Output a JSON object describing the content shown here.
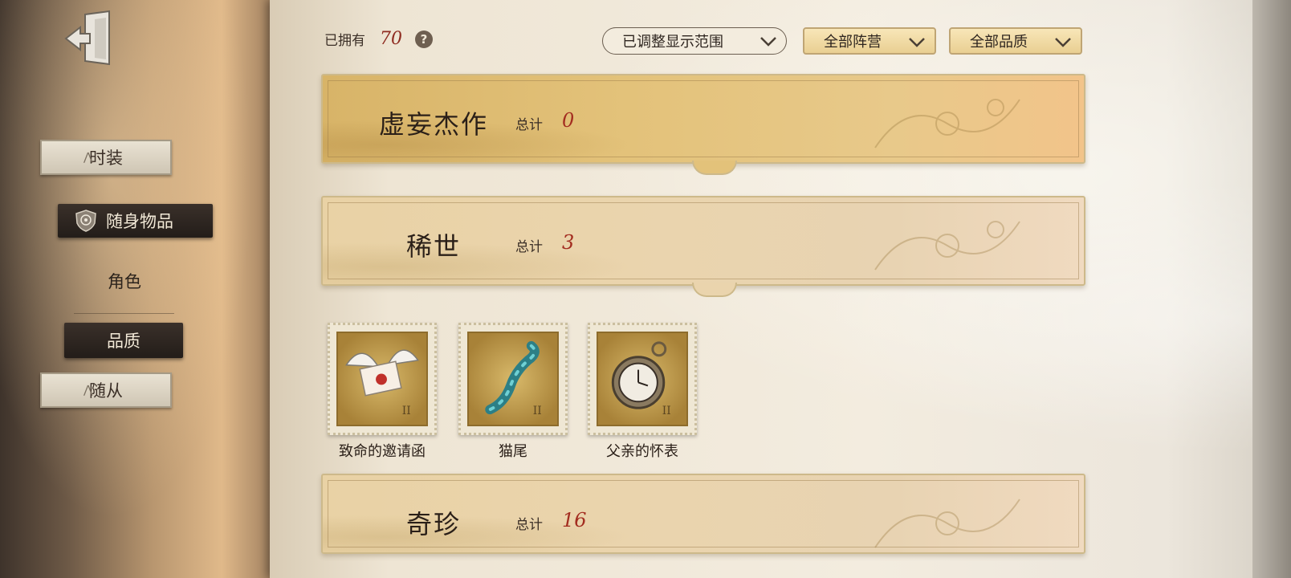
{
  "sidebar": {
    "items": [
      {
        "label": "时装"
      },
      {
        "label": "随身物品"
      },
      {
        "label": "角色"
      },
      {
        "label": "品质"
      },
      {
        "label": "随从"
      }
    ]
  },
  "header": {
    "owned_label": "已拥有",
    "owned_count": "70",
    "help_glyph": "?",
    "range_filter": "已调整显示范围",
    "faction_filter": "全部阵营",
    "quality_filter": "全部品质"
  },
  "sections": [
    {
      "name": "虚妄杰作",
      "total_label": "总计",
      "count": "0"
    },
    {
      "name": "稀世",
      "total_label": "总计",
      "count": "3"
    },
    {
      "name": "奇珍",
      "total_label": "总计",
      "count": "16"
    }
  ],
  "items": [
    {
      "name": "致命的邀请函",
      "icon": "winged-letter-icon"
    },
    {
      "name": "猫尾",
      "icon": "cat-tail-icon"
    },
    {
      "name": "父亲的怀表",
      "icon": "pocket-watch-icon"
    }
  ],
  "colors": {
    "count_red": "#a32d20",
    "gold_band": "#e3c27a",
    "pale_band": "#ead4ad",
    "dark_button": "#2a221d"
  }
}
